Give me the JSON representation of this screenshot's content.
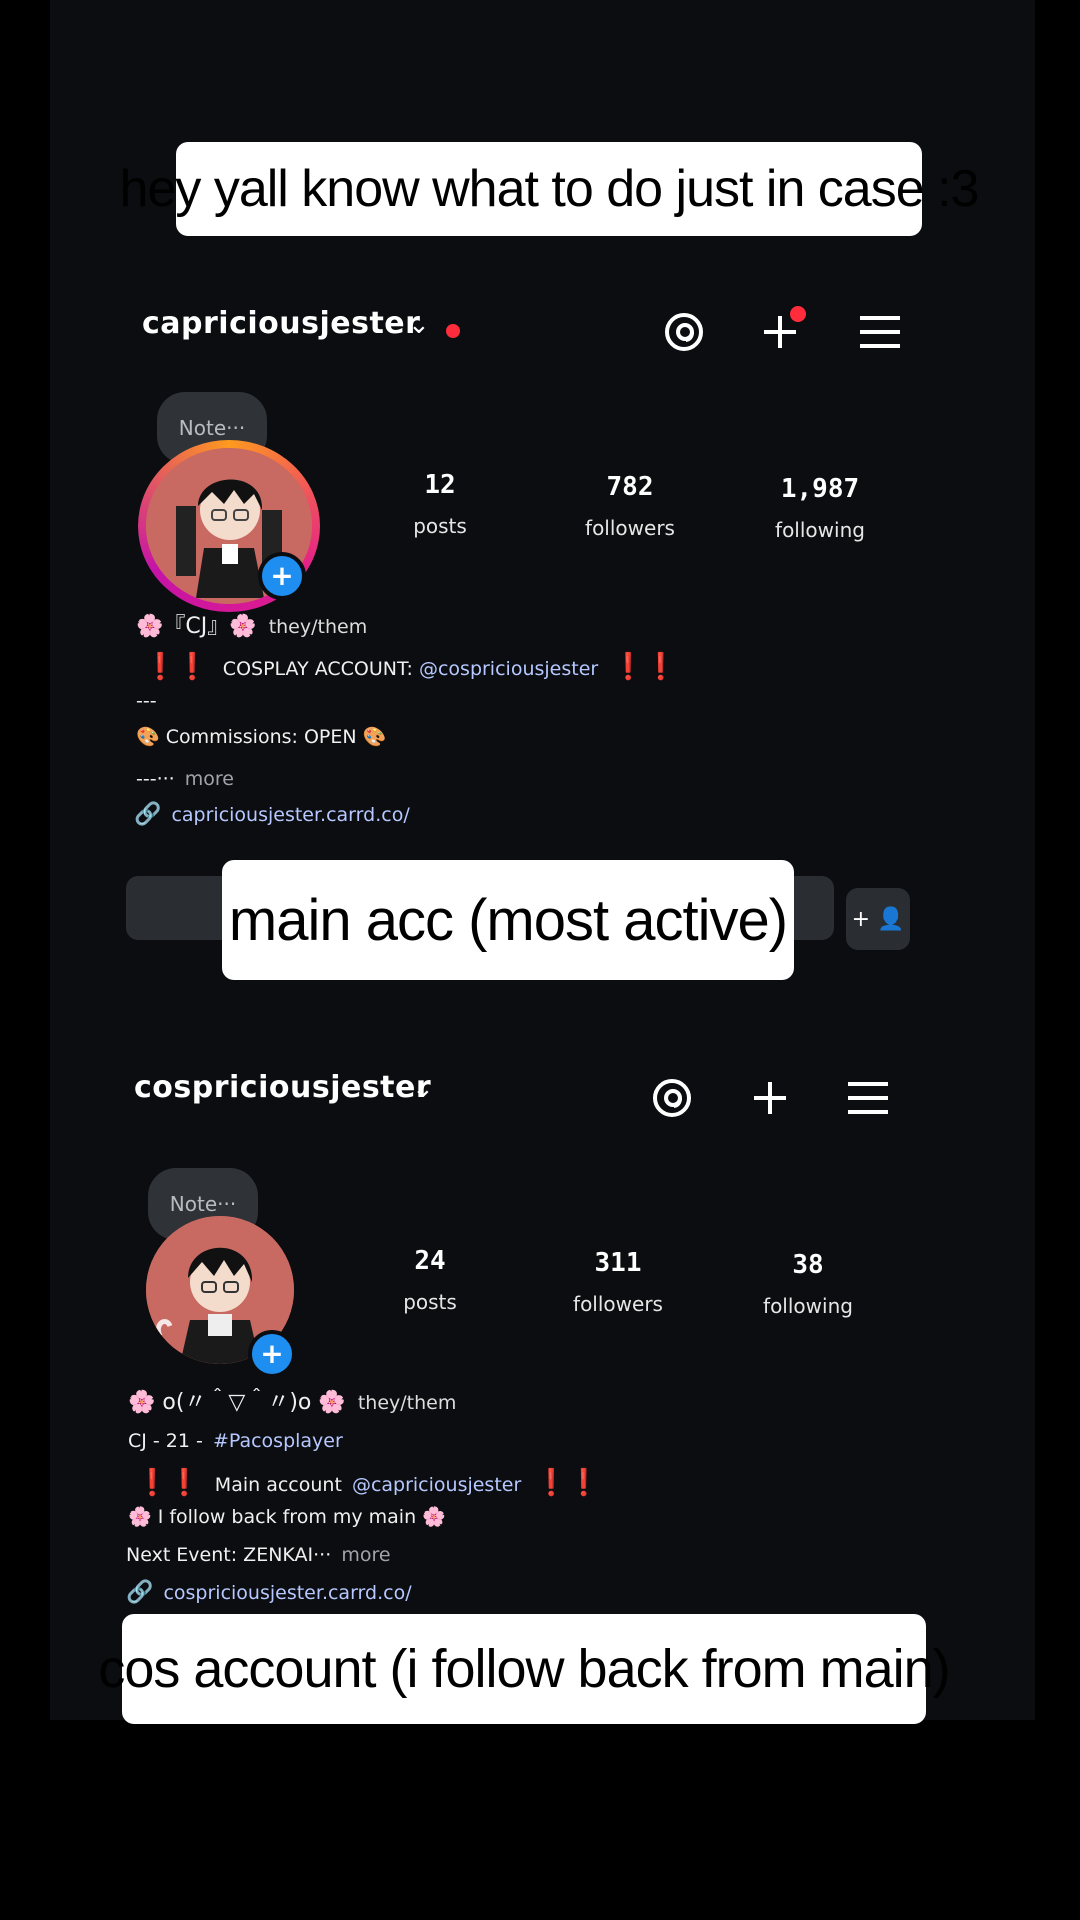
{
  "captions": {
    "top": "hey yall know what to do just in case :3",
    "main": "main acc (most active)",
    "cos": "cos account (i follow back from main)"
  },
  "profile1": {
    "username": "capriciousjester",
    "note": "Note···",
    "stats": [
      {
        "num": "12",
        "label": "posts"
      },
      {
        "num": "782",
        "label": "followers"
      },
      {
        "num": "1,987",
        "label": "following"
      }
    ],
    "bio": {
      "line1_prefix": "🌸『CJ』🌸",
      "line1_pronouns": "they/them",
      "line2_text": "COSPLAY ACCOUNT:",
      "line2_mention": "@cospriciousjester",
      "line3": "---",
      "line4": "🎨 Commissions: OPEN 🎨",
      "line5_text": "---···",
      "line5_more": "more",
      "link": "capriciousjester.carrd.co/"
    },
    "add_friend_label": "+ 👤"
  },
  "profile2": {
    "username": "cospriciousjester",
    "note": "Note···",
    "stats": [
      {
        "num": "24",
        "label": "posts"
      },
      {
        "num": "311",
        "label": "followers"
      },
      {
        "num": "38",
        "label": "following"
      }
    ],
    "bio": {
      "line1_prefix": "🌸 o(〃＾▽＾〃)o 🌸",
      "line1_pronouns": "they/them",
      "line2_text": "CJ - 21 -",
      "line2_tag": "#Pacosplayer",
      "line3_text": "Main account",
      "line3_mention": "@capriciousjester",
      "line4": "🌸 I follow back from my main 🌸",
      "line5_text": "Next Event: ZENKAI···",
      "line5_more": "more",
      "link": "cospriciousjester.carrd.co/"
    }
  },
  "colors": {
    "background": "#000000",
    "panel": "#0b0d10",
    "accent_blue": "#1f8ef1",
    "notification_red": "#ff2d3c",
    "link_blue": "#b6c8ff"
  }
}
